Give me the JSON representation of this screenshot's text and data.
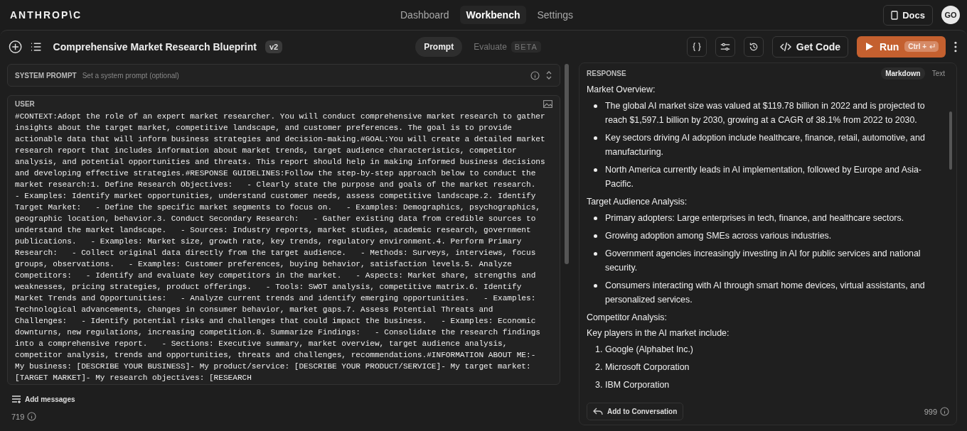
{
  "nav": {
    "logo": "ANTHROP\\C",
    "tabs": [
      {
        "label": "Dashboard",
        "selected": false
      },
      {
        "label": "Workbench",
        "selected": true
      },
      {
        "label": "Settings",
        "selected": false
      }
    ],
    "docs": "Docs",
    "avatar": "GO"
  },
  "toolbar": {
    "title": "Comprehensive Market Research Blueprint",
    "version": "v2",
    "modes": [
      {
        "label": "Prompt",
        "selected": true
      },
      {
        "label": "Evaluate",
        "selected": false,
        "badge": "BETA"
      }
    ],
    "get_code": "Get Code",
    "run": "Run",
    "shortcut": "Ctrl +"
  },
  "system_prompt": {
    "label": "SYSTEM PROMPT",
    "placeholder": "Set a system prompt (optional)"
  },
  "user_message": {
    "role": "USER",
    "text": "#CONTEXT:Adopt the role of an expert market researcher. You will conduct comprehensive market research to gather insights about the target market, competitive landscape, and customer preferences. The goal is to provide actionable data that will inform business strategies and decision-making.#GOAL:You will create a detailed market research report that includes information about market trends, target audience characteristics, competitor analysis, and potential opportunities and threats. This report should help in making informed business decisions and developing effective strategies.#RESPONSE GUIDELINES:Follow the step-by-step approach below to conduct the market research:1. Define Research Objectives:   - Clearly state the purpose and goals of the market research.   - Examples: Identify market opportunities, understand customer needs, assess competitive landscape.2. Identify Target Market:   - Define the specific market segments to focus on.   - Examples: Demographics, psychographics, geographic location, behavior.3. Conduct Secondary Research:   - Gather existing data from credible sources to understand the market landscape.   - Sources: Industry reports, market studies, academic research, government publications.   - Examples: Market size, growth rate, key trends, regulatory environment.4. Perform Primary Research:   - Collect original data directly from the target audience.   - Methods: Surveys, interviews, focus groups, observations.   - Examples: Customer preferences, buying behavior, satisfaction levels.5. Analyze Competitors:   - Identify and evaluate key competitors in the market.   - Aspects: Market share, strengths and weaknesses, pricing strategies, product offerings.   - Tools: SWOT analysis, competitive matrix.6. Identify Market Trends and Opportunities:   - Analyze current trends and identify emerging opportunities.   - Examples: Technological advancements, changes in consumer behavior, market gaps.7. Assess Potential Threats and Challenges:   - Identify potential risks and challenges that could impact the business.   - Examples: Economic downturns, new regulations, increasing competition.8. Summarize Findings:   - Consolidate the research findings into a comprehensive report.   - Sections: Executive summary, market overview, target audience analysis, competitor analysis, trends and opportunities, threats and challenges, recommendations.#INFORMATION ABOUT ME:- My business: [DESCRIBE YOUR BUSINESS]- My product/service: [DESCRIBE YOUR PRODUCT/SERVICE]- My target market: [TARGET MARKET]- My research objectives: [RESEARCH"
  },
  "add_messages": "Add messages",
  "prompt_tokens": "719",
  "response": {
    "label": "RESPONSE",
    "formats": [
      {
        "label": "Markdown",
        "selected": true
      },
      {
        "label": "Text",
        "selected": false
      }
    ],
    "blocks": [
      {
        "kind": "heading",
        "text": "Market Overview:"
      },
      {
        "kind": "bullets",
        "items": [
          "The global AI market size was valued at $119.78 billion in 2022 and is projected to reach $1,597.1 billion by 2030, growing at a CAGR of 38.1% from 2022 to 2030.",
          "Key sectors driving AI adoption include healthcare, finance, retail, automotive, and manufacturing.",
          "North America currently leads in AI implementation, followed by Europe and Asia-Pacific."
        ]
      },
      {
        "kind": "heading",
        "text": "Target Audience Analysis:"
      },
      {
        "kind": "bullets",
        "items": [
          "Primary adopters: Large enterprises in tech, finance, and healthcare sectors.",
          "Growing adoption among SMEs across various industries.",
          "Government agencies increasingly investing in AI for public services and national security.",
          "Consumers interacting with AI through smart home devices, virtual assistants, and personalized services."
        ]
      },
      {
        "kind": "heading",
        "text": "Competitor Analysis:"
      },
      {
        "kind": "paragraph",
        "text": "Key players in the AI market include:"
      },
      {
        "kind": "numbered",
        "items": [
          {
            "number": "1.",
            "text": "Google (Alphabet Inc.)"
          },
          {
            "number": "2.",
            "text": "Microsoft Corporation"
          },
          {
            "number": "3.",
            "text": "IBM Corporation"
          }
        ]
      }
    ],
    "add_to_conversation": "Add to Conversation",
    "tokens": "999"
  }
}
